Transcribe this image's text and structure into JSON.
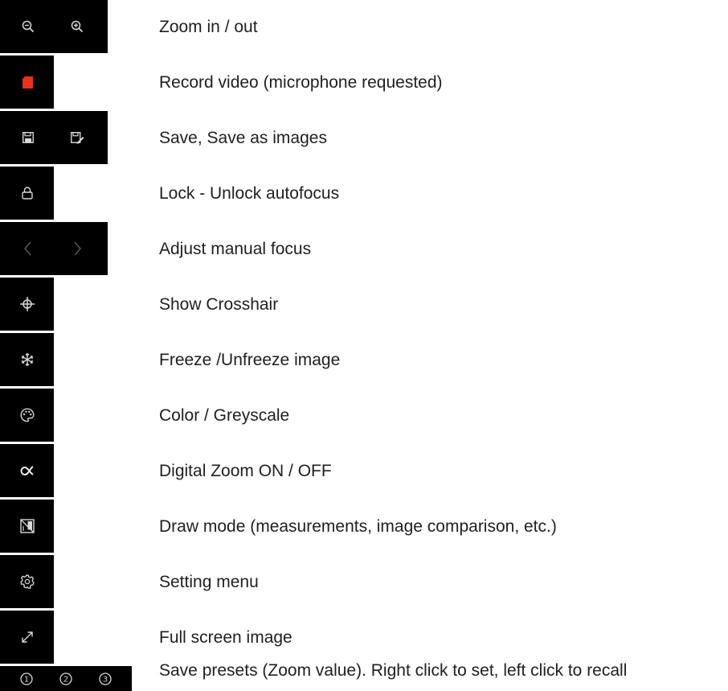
{
  "colors": {
    "tile_bg": "#000000",
    "icon": "#d8d8d8",
    "icon_dim": "#5a5a5a",
    "record": "#e8311d",
    "text": "#1f1f1f"
  },
  "legend": [
    {
      "id": "zoom",
      "label": "Zoom in / out",
      "buttons": [
        {
          "icon": "zoom-out-icon"
        },
        {
          "icon": "zoom-in-icon"
        }
      ]
    },
    {
      "id": "record",
      "label": "Record video (microphone requested)",
      "buttons": [
        {
          "icon": "record-icon"
        }
      ]
    },
    {
      "id": "save",
      "label": "Save, Save as images",
      "buttons": [
        {
          "icon": "save-icon"
        },
        {
          "icon": "save-as-icon"
        }
      ]
    },
    {
      "id": "lock",
      "label": "Lock - Unlock autofocus",
      "buttons": [
        {
          "icon": "lock-icon"
        }
      ]
    },
    {
      "id": "focus",
      "label": "Adjust manual focus",
      "buttons": [
        {
          "icon": "chevron-left-icon"
        },
        {
          "icon": "chevron-right-icon"
        }
      ]
    },
    {
      "id": "crosshair",
      "label": "Show Crosshair",
      "buttons": [
        {
          "icon": "crosshair-icon"
        }
      ]
    },
    {
      "id": "freeze",
      "label": "Freeze /Unfreeze image",
      "buttons": [
        {
          "icon": "snowflake-icon"
        }
      ]
    },
    {
      "id": "color",
      "label": "Color / Greyscale",
      "buttons": [
        {
          "icon": "palette-icon"
        }
      ]
    },
    {
      "id": "digital-zoom",
      "label": "Digital Zoom ON / OFF",
      "buttons": [
        {
          "icon": "proportional-icon"
        }
      ]
    },
    {
      "id": "draw",
      "label": "Draw mode (measurements, image comparison, etc.)",
      "buttons": [
        {
          "icon": "draw-mode-icon"
        }
      ]
    },
    {
      "id": "settings",
      "label": "Setting menu",
      "buttons": [
        {
          "icon": "gear-icon"
        }
      ]
    },
    {
      "id": "fullscreen",
      "label": "Full screen image",
      "buttons": [
        {
          "icon": "expand-icon"
        }
      ]
    },
    {
      "id": "presets",
      "label": "Save presets (Zoom value). Right click to set, left click to recall",
      "buttons": [
        {
          "icon": "preset-1-icon",
          "text": "1"
        },
        {
          "icon": "preset-2-icon",
          "text": "2"
        },
        {
          "icon": "preset-3-icon",
          "text": "3"
        }
      ]
    }
  ]
}
